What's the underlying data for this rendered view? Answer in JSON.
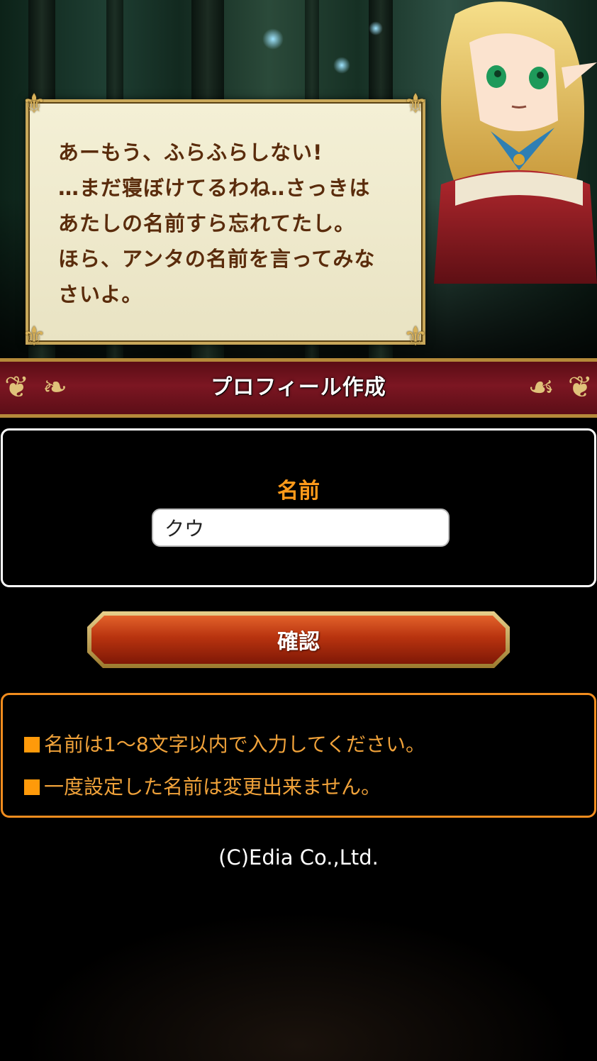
{
  "scene": {
    "dialogue_lines": [
      "あーもう、ふらふらしない!",
      "…まだ寝ぼけてるわね‥さっきは",
      "あたしの名前すら忘れてたし。",
      "ほら、アンタの名前を言ってみな",
      "さいよ。"
    ]
  },
  "banner": {
    "title": "プロフィール作成"
  },
  "form": {
    "name_label": "名前",
    "name_value": "クウ",
    "confirm_label": "確認"
  },
  "notes": {
    "items": [
      "名前は1～8文字以内で入力してください。",
      "一度設定した名前は変更出来ません。"
    ]
  },
  "footer": {
    "copyright": "(C)Edia Co.,Ltd."
  },
  "colors": {
    "accent_orange": "#ff9a1a",
    "banner_red": "#7c1622",
    "button_red": "#b8330f",
    "gold": "#c9a85a"
  }
}
